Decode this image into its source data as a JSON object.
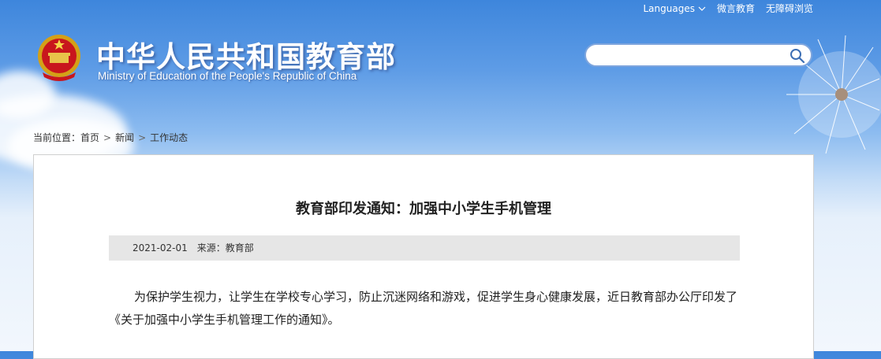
{
  "header": {
    "top_links": {
      "languages": "Languages",
      "weiyan": "微言教育",
      "accessible": "无障碍浏览"
    },
    "title": "中华人民共和国教育部",
    "subtitle": "Ministry of Education of the People's Republic of China",
    "search": {
      "placeholder": ""
    }
  },
  "breadcrumb": {
    "prefix": "当前位置：",
    "items": [
      "首页",
      "新闻",
      "工作动态"
    ]
  },
  "article": {
    "title": "教育部印发通知：加强中小学生手机管理",
    "date": "2021-02-01",
    "source": "来源：教育部",
    "paragraph": "为保护学生视力，让学生在学校专心学习，防止沉迷网络和游戏，促进学生身心健康发展，近日教育部办公厅印发了《关于加强中小学生手机管理工作的通知》。"
  },
  "icons": [
    "national-emblem-icon",
    "chevron-down-icon",
    "search-icon",
    "chevron-right-icon"
  ],
  "colors": {
    "sky_top": "#3e86dc",
    "panel_border": "#cfcfcf",
    "meta_bg": "#e6e6e6",
    "search_border": "#7ea5dd"
  }
}
